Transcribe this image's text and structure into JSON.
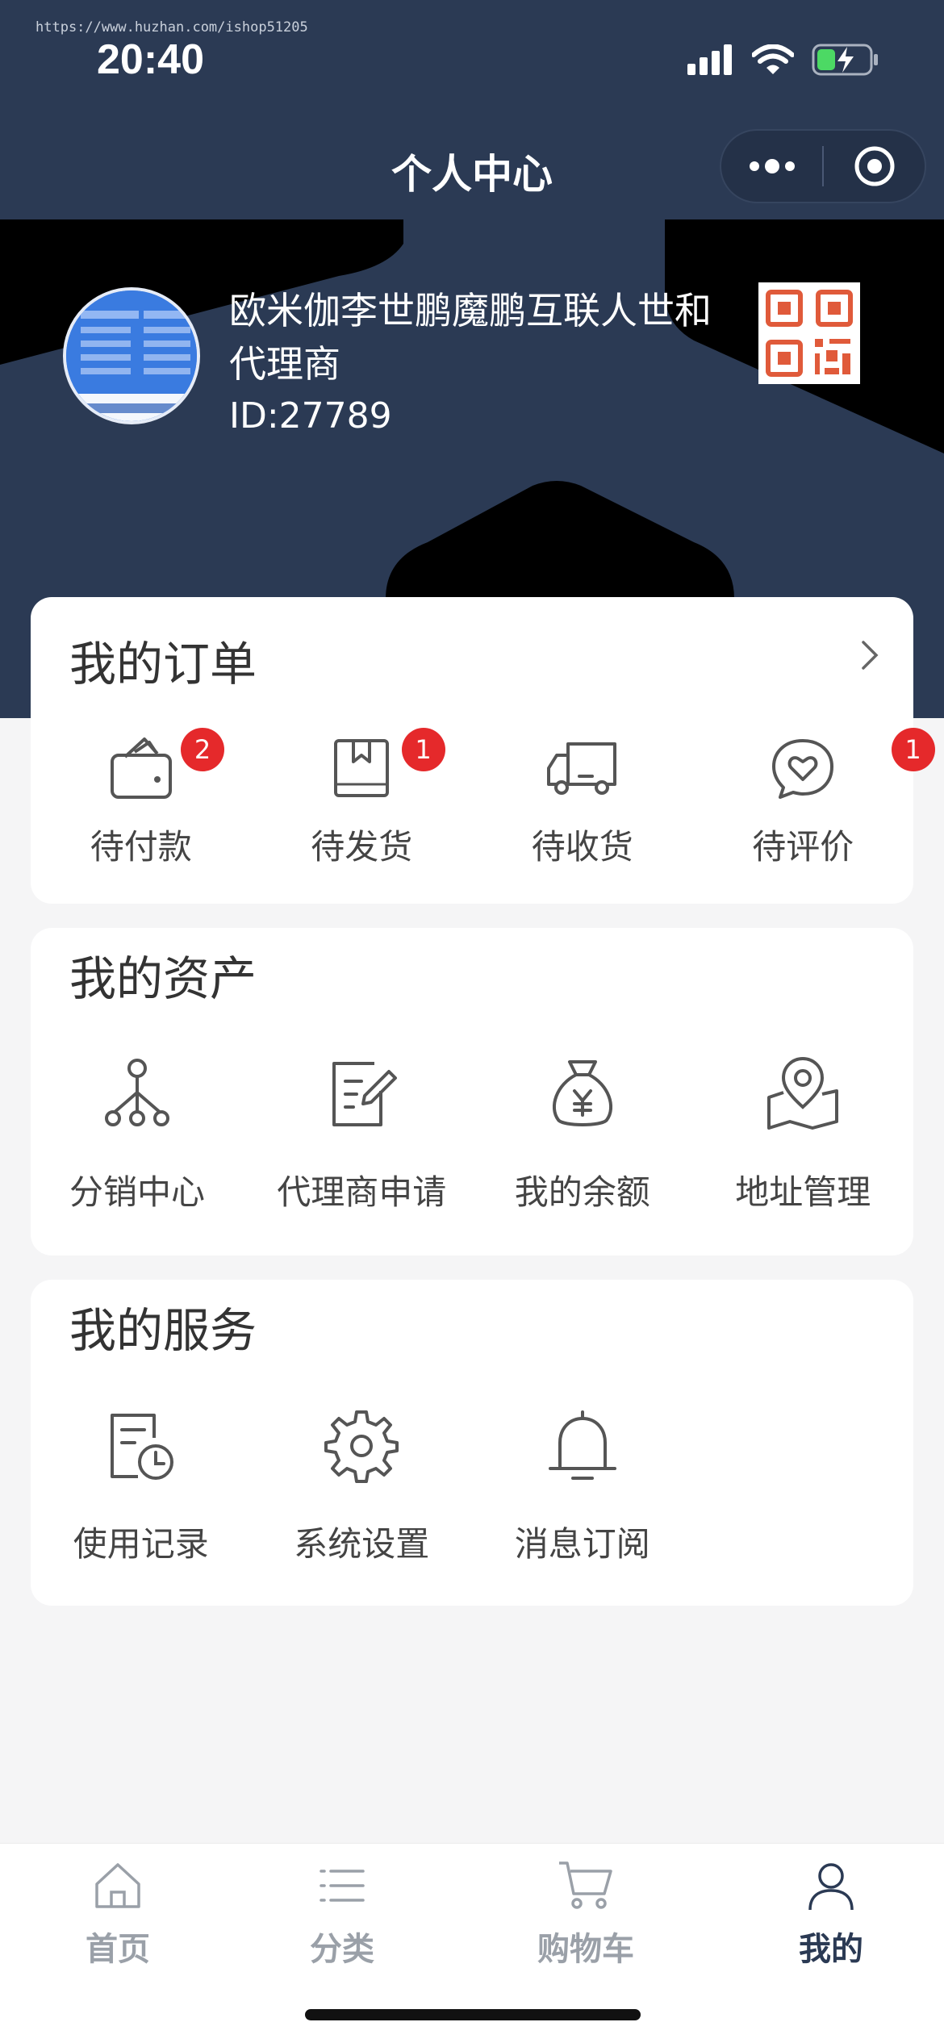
{
  "watermark": "https://www.huzhan.com/ishop51205",
  "status_bar": {
    "time": "20:40"
  },
  "nav": {
    "title": "个人中心"
  },
  "user": {
    "name": "欧米伽李世鹏魔鹏互联人世和代理商",
    "id": "ID:27789",
    "avatar_text": [
      "小程序商城定制",
      "ERP系统开发",
      "积分商城",
      "企业官网",
      "智慧农业系统",
      "数字化软件帮扶中"
    ]
  },
  "orders": {
    "title": "我的订单",
    "items": [
      {
        "label": "待付款",
        "icon": "wallet-icon",
        "badge": "2"
      },
      {
        "label": "待发货",
        "icon": "package-icon",
        "badge": "1"
      },
      {
        "label": "待收货",
        "icon": "truck-icon",
        "badge": ""
      },
      {
        "label": "待评价",
        "icon": "heart-chat-icon",
        "badge": "1"
      }
    ]
  },
  "assets": {
    "title": "我的资产",
    "items": [
      {
        "label": "分销中心",
        "icon": "network-icon"
      },
      {
        "label": "代理商申请",
        "icon": "edit-doc-icon"
      },
      {
        "label": "我的余额",
        "icon": "money-bag-icon"
      },
      {
        "label": "地址管理",
        "icon": "location-map-icon"
      }
    ]
  },
  "services": {
    "title": "我的服务",
    "items": [
      {
        "label": "使用记录",
        "icon": "record-clock-icon"
      },
      {
        "label": "系统设置",
        "icon": "gear-icon"
      },
      {
        "label": "消息订阅",
        "icon": "bell-icon"
      }
    ]
  },
  "tabbar": {
    "items": [
      {
        "label": "首页",
        "icon": "home-icon"
      },
      {
        "label": "分类",
        "icon": "list-icon"
      },
      {
        "label": "购物车",
        "icon": "cart-icon"
      },
      {
        "label": "我的",
        "icon": "user-icon"
      }
    ],
    "active": "我的"
  },
  "colors": {
    "header_bg": "#2b3a54",
    "badge": "#e5292b",
    "qr": "#e05a3a",
    "active_tab": "#2b3a54"
  }
}
